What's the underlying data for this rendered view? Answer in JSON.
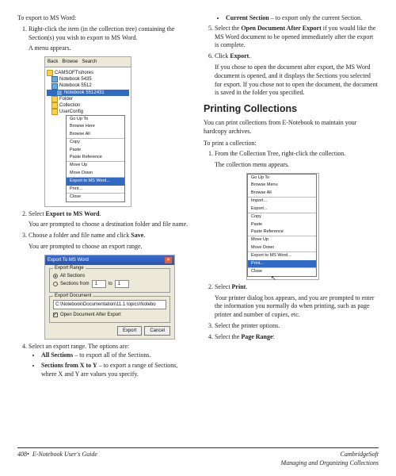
{
  "left": {
    "intro": "To export to MS Word:",
    "step1": "Right-click the item (in the collection tree) containing the Section(s) you wish to export to MS Word.",
    "step1_after": "A menu appears.",
    "toolbar": {
      "back": "Back",
      "browse": "Browse",
      "search": "Search"
    },
    "tree": {
      "root": "CAMSOFT\\shores",
      "n1": "Notebook 5435",
      "n2": "Notebook 5512",
      "n3": "Notebook 5512431",
      "folder": "Folder",
      "coll": "Collection",
      "ucfg": "UserConfig"
    },
    "menu": {
      "goup": "Go Up To",
      "bhere": "Browse Here",
      "ball": "Browse All",
      "copy": "Copy",
      "paste": "Paste",
      "pref": "Paste Reference",
      "mup": "Move Up",
      "mdn": "Move Down",
      "export": "Export to MS Word...",
      "print": "Print...",
      "close": "Close"
    },
    "step2_a": "Select ",
    "step2_b": "Export to MS Word",
    "step2_after": "You are prompted to choose a destination folder and file name.",
    "step3_a": "Choose a folder and file name and click ",
    "step3_b": "Save",
    "step3_after": "You are prompted to choose an export range.",
    "dlg": {
      "title": "Export To MS Word",
      "grp1": "Export Range",
      "allsec": "All Sections",
      "secfrom": "Sections from",
      "to": "to",
      "v1": "1",
      "v2": "1",
      "grp2": "Export Document",
      "path": "C:\\Notebook\\Documentation\\11.1 topics\\Notebo",
      "open": "Open Document After Export",
      "export": "Export",
      "cancel": "Cancel"
    },
    "step4": "Select an export range. The options are:",
    "opt1_a": "All Sections",
    "opt1_b": " – to export all of the Sections.",
    "opt2_a": "Sections from X to Y",
    "opt2_b": " – to export a range of Sections, where X and Y are values you specify."
  },
  "right": {
    "bullet_a": "Current Section",
    "bullet_b": " – to export only the current Section.",
    "step5_a": "Select the ",
    "step5_b": "Open Document After Export",
    "step5_c": " if you would like the MS Word document to be opened immediately after the export is complete.",
    "step6_a": "Click ",
    "step6_b": "Export",
    "step6_c": ".",
    "step6_after": "If you chose to open the document after export, the MS Word document is opened, and it displays the Sections you selected for export. If you chose not to open the document, the document is saved in the folder you specified.",
    "h1": "Printing Collections",
    "p1": "You can print collections from E-Notebook to maintain your hardcopy archives.",
    "p2": "To print a collection:",
    "s1": "From the Collection Tree, right-click the collection.",
    "s1_after": "The collection menu appears.",
    "menu": {
      "goup": "Go Up To",
      "bmenu": "Browse Menu",
      "ball": "Browse All",
      "import": "Import...",
      "export": "Export...",
      "copy": "Copy",
      "paste": "Paste",
      "pref": "Paste Reference",
      "mup": "Move Up",
      "mdn": "Move Down",
      "exms": "Export to MS Word...",
      "print": "Print...",
      "close": "Close"
    },
    "s2_a": "Select ",
    "s2_b": "Print",
    "s2_c": ".",
    "s2_after": "Your printer dialog box appears, and you are prompted to enter the information you normally do when printing, such as page printer and number of copies, etc.",
    "s3": "Select the printer options.",
    "s4_a": "Select the ",
    "s4_b": "Page Range",
    "s4_c": ":"
  },
  "footer": {
    "page": "408",
    "guide": "E-Notebook User's Guide",
    "brand": "CambridgeSoft",
    "section": "Managing and Organizing Collections"
  }
}
